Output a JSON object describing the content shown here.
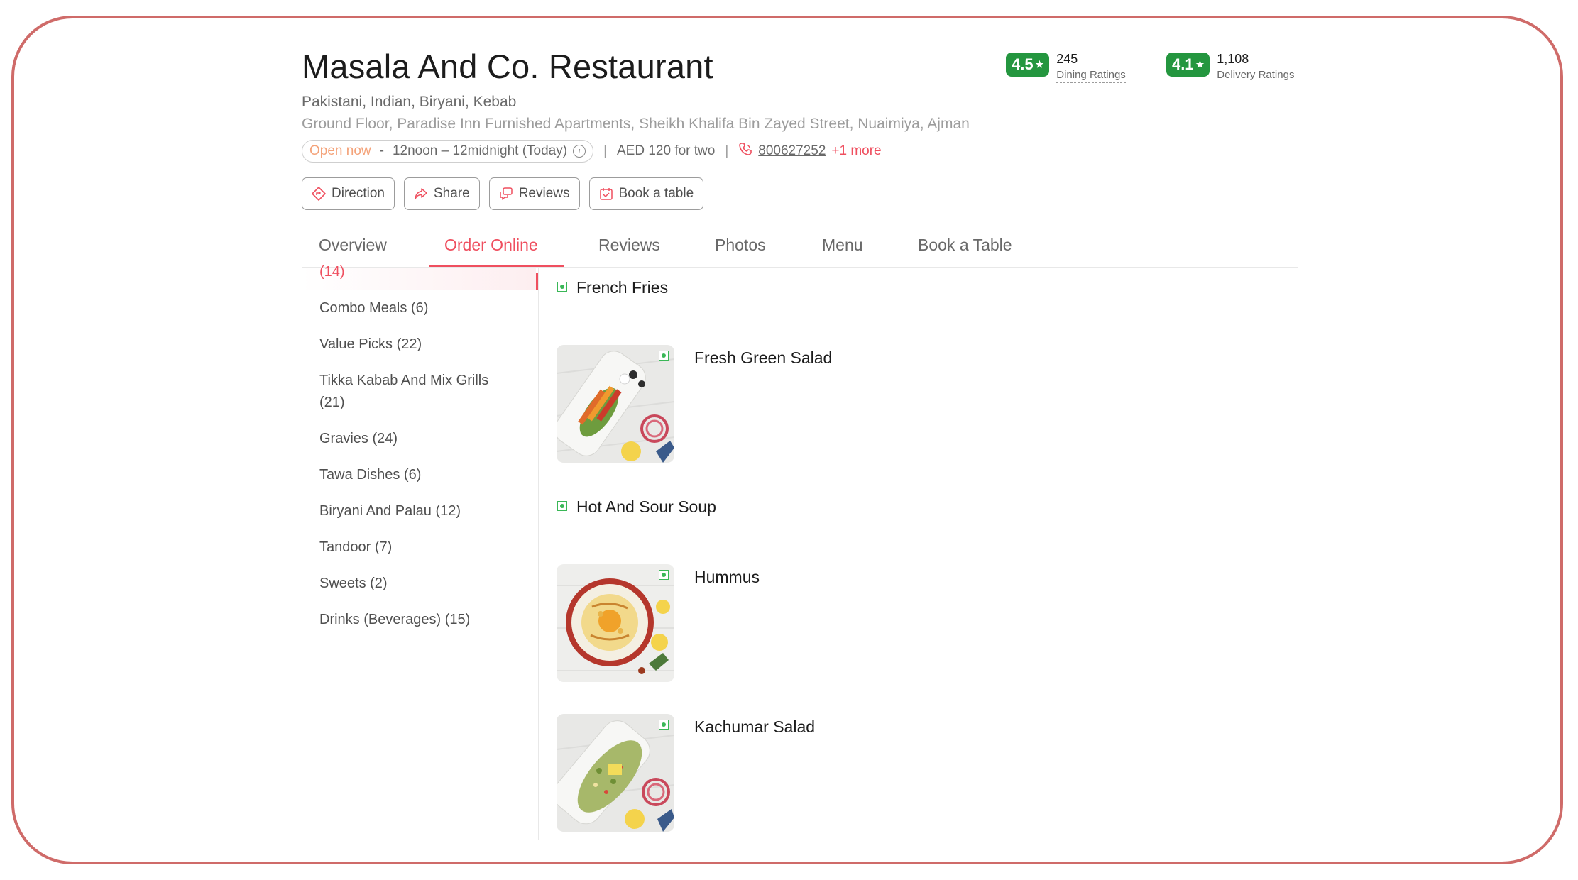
{
  "restaurant": {
    "name": "Masala And Co. Restaurant",
    "cuisines": "Pakistani, Indian, Biryani, Kebab",
    "address": "Ground Floor, Paradise Inn Furnished Apartments, Sheikh Khalifa Bin Zayed Street, Nuaimiya, Ajman",
    "status": "Open now",
    "timing": "12noon – 12midnight (Today)",
    "cost": "AED 120 for two",
    "phone": "800627252",
    "phone_more": "+1 more"
  },
  "ratings": {
    "dining": {
      "score": "4.5",
      "count": "245",
      "label": "Dining Ratings"
    },
    "delivery": {
      "score": "4.1",
      "count": "1,108",
      "label": "Delivery Ratings"
    },
    "star": "★",
    "badge_color": "#24963f"
  },
  "actions": [
    {
      "label": "Direction",
      "icon": "direction-icon"
    },
    {
      "label": "Share",
      "icon": "share-icon"
    },
    {
      "label": "Reviews",
      "icon": "reviews-icon"
    },
    {
      "label": "Book a table",
      "icon": "calendar-icon"
    }
  ],
  "tabs": [
    {
      "label": "Overview"
    },
    {
      "label": "Order Online",
      "active": true
    },
    {
      "label": "Reviews"
    },
    {
      "label": "Photos"
    },
    {
      "label": "Menu"
    },
    {
      "label": "Book a Table"
    }
  ],
  "categories": [
    {
      "label": "(14)"
    },
    {
      "label": "Combo Meals (6)"
    },
    {
      "label": "Value Picks (22)"
    },
    {
      "label": "Tikka Kabab And Mix Grills",
      "label2": "(21)"
    },
    {
      "label": "Gravies (24)"
    },
    {
      "label": "Tawa Dishes (6)"
    },
    {
      "label": "Biryani And Palau (12)"
    },
    {
      "label": "Tandoor (7)"
    },
    {
      "label": "Sweets (2)"
    },
    {
      "label": "Drinks (Beverages) (15)"
    }
  ],
  "dishes": [
    {
      "name": "French Fries",
      "has_image": false,
      "veg": true
    },
    {
      "name": "Fresh Green Salad",
      "has_image": true,
      "veg": true
    },
    {
      "name": "Hot And Sour Soup",
      "has_image": false,
      "veg": true
    },
    {
      "name": "Hummus",
      "has_image": true,
      "veg": true
    },
    {
      "name": "Kachumar Salad",
      "has_image": true,
      "veg": true
    }
  ],
  "colors": {
    "accent": "#ef4f5f",
    "frame": "#cf6b69",
    "veg": "#3ab757"
  }
}
